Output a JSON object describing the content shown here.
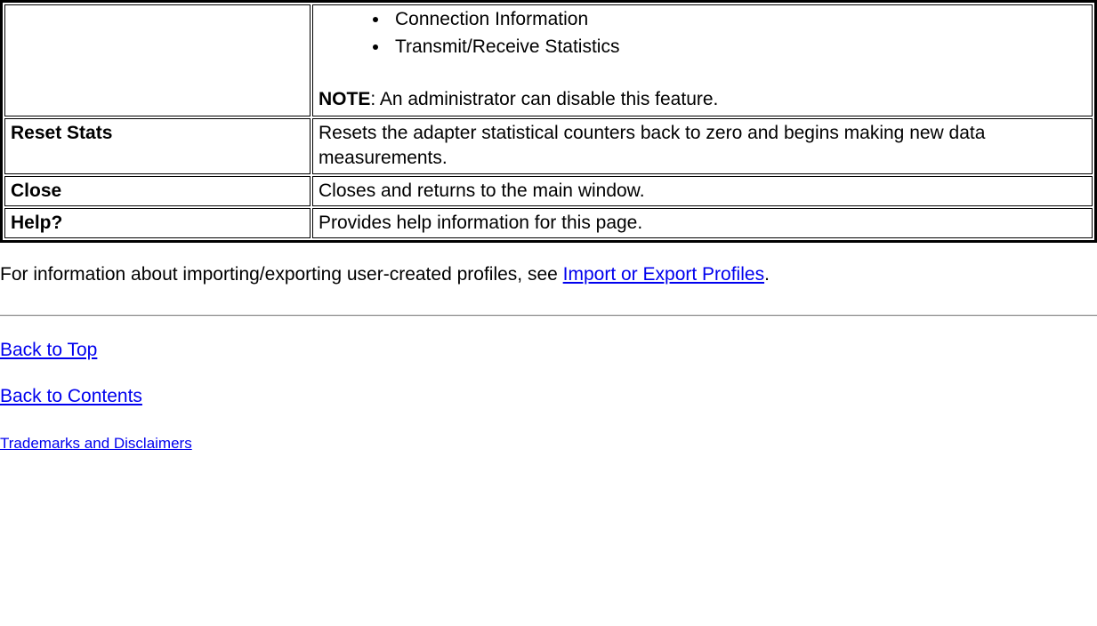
{
  "table": {
    "row0": {
      "label": "",
      "bullets": [
        "Connection Information",
        "Transmit/Receive Statistics"
      ],
      "note_label": "NOTE",
      "note_text": ": An administrator can disable this feature."
    },
    "row1": {
      "label": "Reset Stats",
      "desc": "Resets the adapter statistical counters back to zero and begins making new data measurements."
    },
    "row2": {
      "label": "Close",
      "desc": "Closes and returns to the main window."
    },
    "row3": {
      "label": "Help?",
      "desc": "Provides help information for this page."
    }
  },
  "para": {
    "pre": "For information about importing/exporting user-created profiles, see ",
    "link": "Import or Export Profiles",
    "post": "."
  },
  "links": {
    "back_top": "Back to Top",
    "back_contents": "Back to Contents",
    "trademarks": "Trademarks and Disclaimers"
  }
}
